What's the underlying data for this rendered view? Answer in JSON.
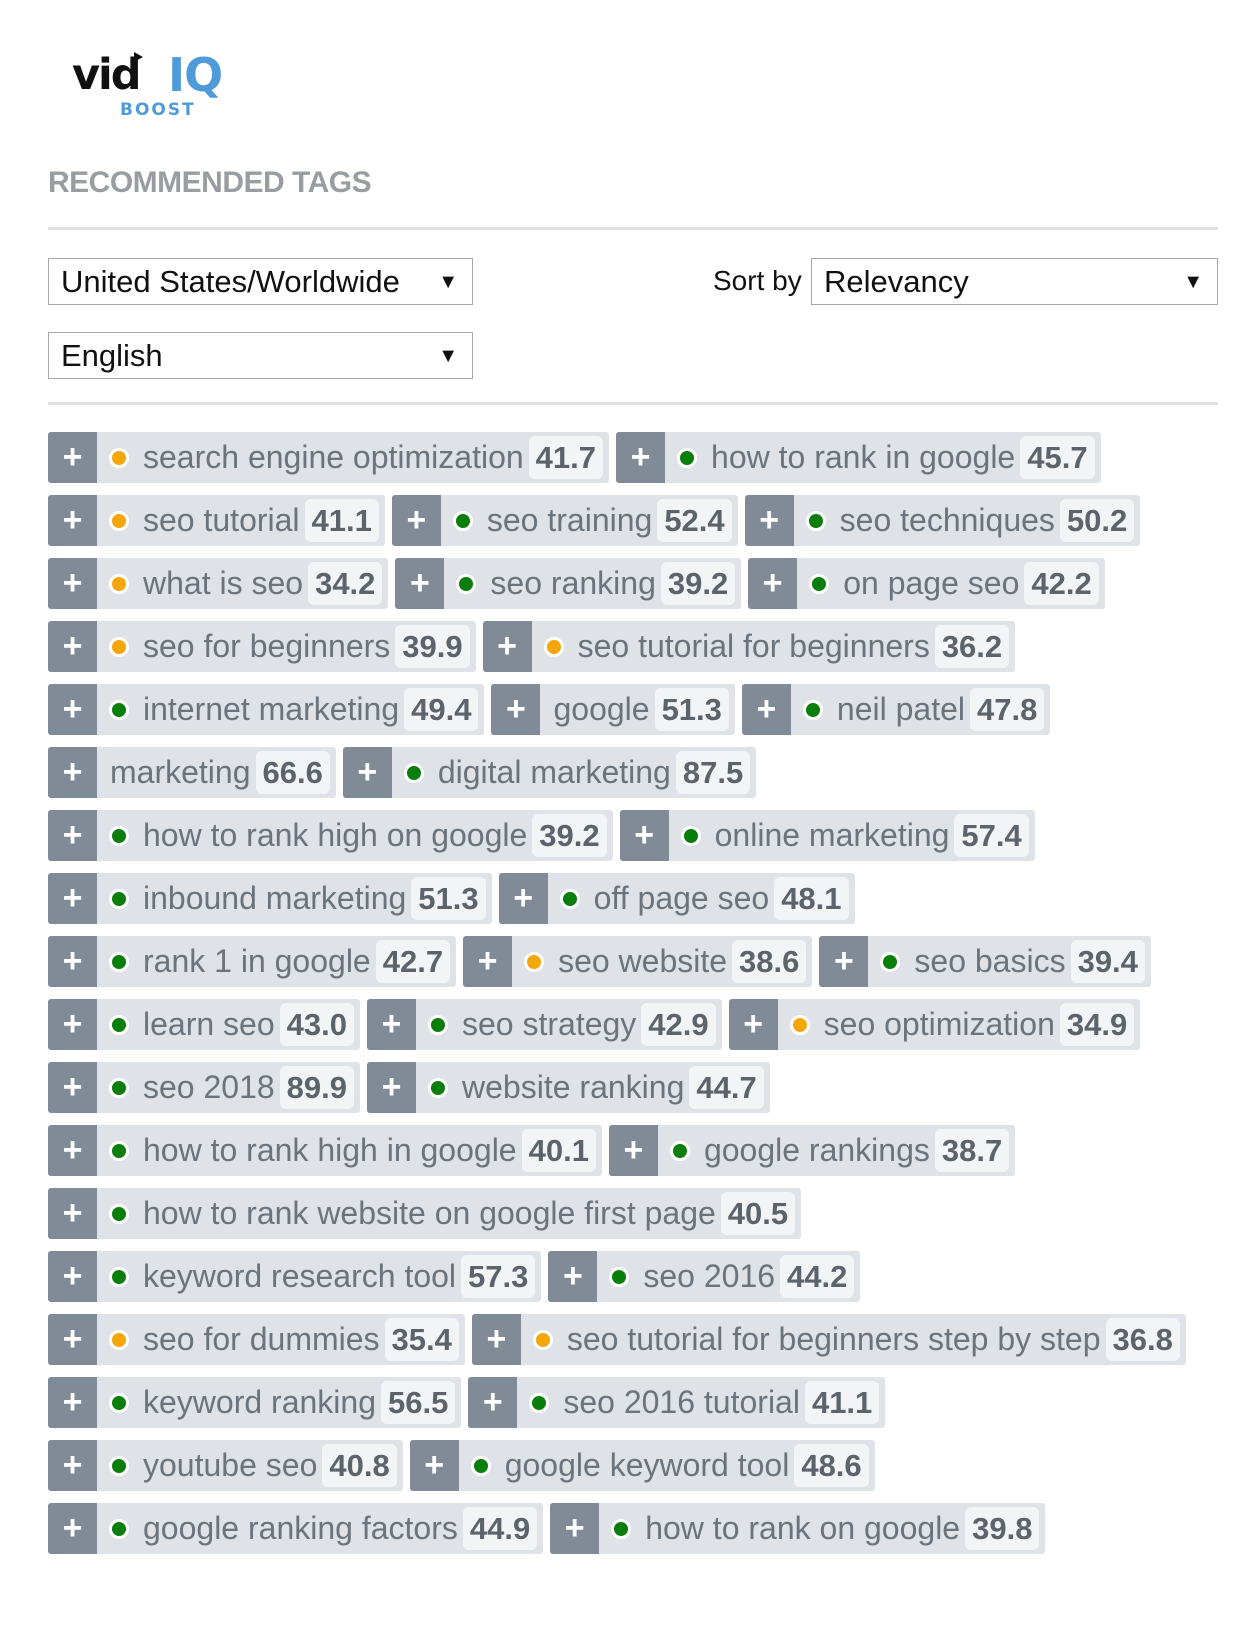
{
  "brand": {
    "logo_main": "vid",
    "logo_accent": "IQ",
    "logo_sub": "BOOST",
    "accent_color": "#4f9bd9"
  },
  "section_title": "RECOMMENDED TAGS",
  "filters": {
    "country": "United States/Worldwide",
    "language": "English",
    "sort_label": "Sort by",
    "sort_value": "Relevancy",
    "dropdown_icon": "▼"
  },
  "status_colors": {
    "green": "#0a7e0a",
    "orange": "#f5a60a"
  },
  "add_icon": "+",
  "tags": [
    {
      "label": "search engine optimization",
      "score": "41.7",
      "status": "orange"
    },
    {
      "label": "how to rank in google",
      "score": "45.7",
      "status": "green"
    },
    {
      "label": "seo tutorial",
      "score": "41.1",
      "status": "orange"
    },
    {
      "label": "seo training",
      "score": "52.4",
      "status": "green"
    },
    {
      "label": "seo techniques",
      "score": "50.2",
      "status": "green"
    },
    {
      "label": "what is seo",
      "score": "34.2",
      "status": "orange"
    },
    {
      "label": "seo ranking",
      "score": "39.2",
      "status": "green"
    },
    {
      "label": "on page seo",
      "score": "42.2",
      "status": "green"
    },
    {
      "label": "seo for beginners",
      "score": "39.9",
      "status": "orange"
    },
    {
      "label": "seo tutorial for beginners",
      "score": "36.2",
      "status": "orange"
    },
    {
      "label": "internet marketing",
      "score": "49.4",
      "status": "green"
    },
    {
      "label": "google",
      "score": "51.3",
      "status": "none"
    },
    {
      "label": "neil patel",
      "score": "47.8",
      "status": "green"
    },
    {
      "label": "marketing",
      "score": "66.6",
      "status": "none"
    },
    {
      "label": "digital marketing",
      "score": "87.5",
      "status": "green"
    },
    {
      "label": "how to rank high on google",
      "score": "39.2",
      "status": "green"
    },
    {
      "label": "online marketing",
      "score": "57.4",
      "status": "green"
    },
    {
      "label": "inbound marketing",
      "score": "51.3",
      "status": "green"
    },
    {
      "label": "off page seo",
      "score": "48.1",
      "status": "green"
    },
    {
      "label": "rank 1 in google",
      "score": "42.7",
      "status": "green"
    },
    {
      "label": "seo website",
      "score": "38.6",
      "status": "orange"
    },
    {
      "label": "seo basics",
      "score": "39.4",
      "status": "green"
    },
    {
      "label": "learn seo",
      "score": "43.0",
      "status": "green"
    },
    {
      "label": "seo strategy",
      "score": "42.9",
      "status": "green"
    },
    {
      "label": "seo optimization",
      "score": "34.9",
      "status": "orange"
    },
    {
      "label": "seo 2018",
      "score": "89.9",
      "status": "green"
    },
    {
      "label": "website ranking",
      "score": "44.7",
      "status": "green"
    },
    {
      "label": "how to rank high in google",
      "score": "40.1",
      "status": "green"
    },
    {
      "label": "google rankings",
      "score": "38.7",
      "status": "green"
    },
    {
      "label": "how to rank website on google first page",
      "score": "40.5",
      "status": "green"
    },
    {
      "label": "keyword research tool",
      "score": "57.3",
      "status": "green"
    },
    {
      "label": "seo 2016",
      "score": "44.2",
      "status": "green"
    },
    {
      "label": "seo for dummies",
      "score": "35.4",
      "status": "orange"
    },
    {
      "label": "seo tutorial for beginners step by step",
      "score": "36.8",
      "status": "orange"
    },
    {
      "label": "keyword ranking",
      "score": "56.5",
      "status": "green"
    },
    {
      "label": "seo 2016 tutorial",
      "score": "41.1",
      "status": "green"
    },
    {
      "label": "youtube seo",
      "score": "40.8",
      "status": "green"
    },
    {
      "label": "google keyword tool",
      "score": "48.6",
      "status": "green"
    },
    {
      "label": "google ranking factors",
      "score": "44.9",
      "status": "green"
    },
    {
      "label": "how to rank on google",
      "score": "39.8",
      "status": "green"
    }
  ]
}
